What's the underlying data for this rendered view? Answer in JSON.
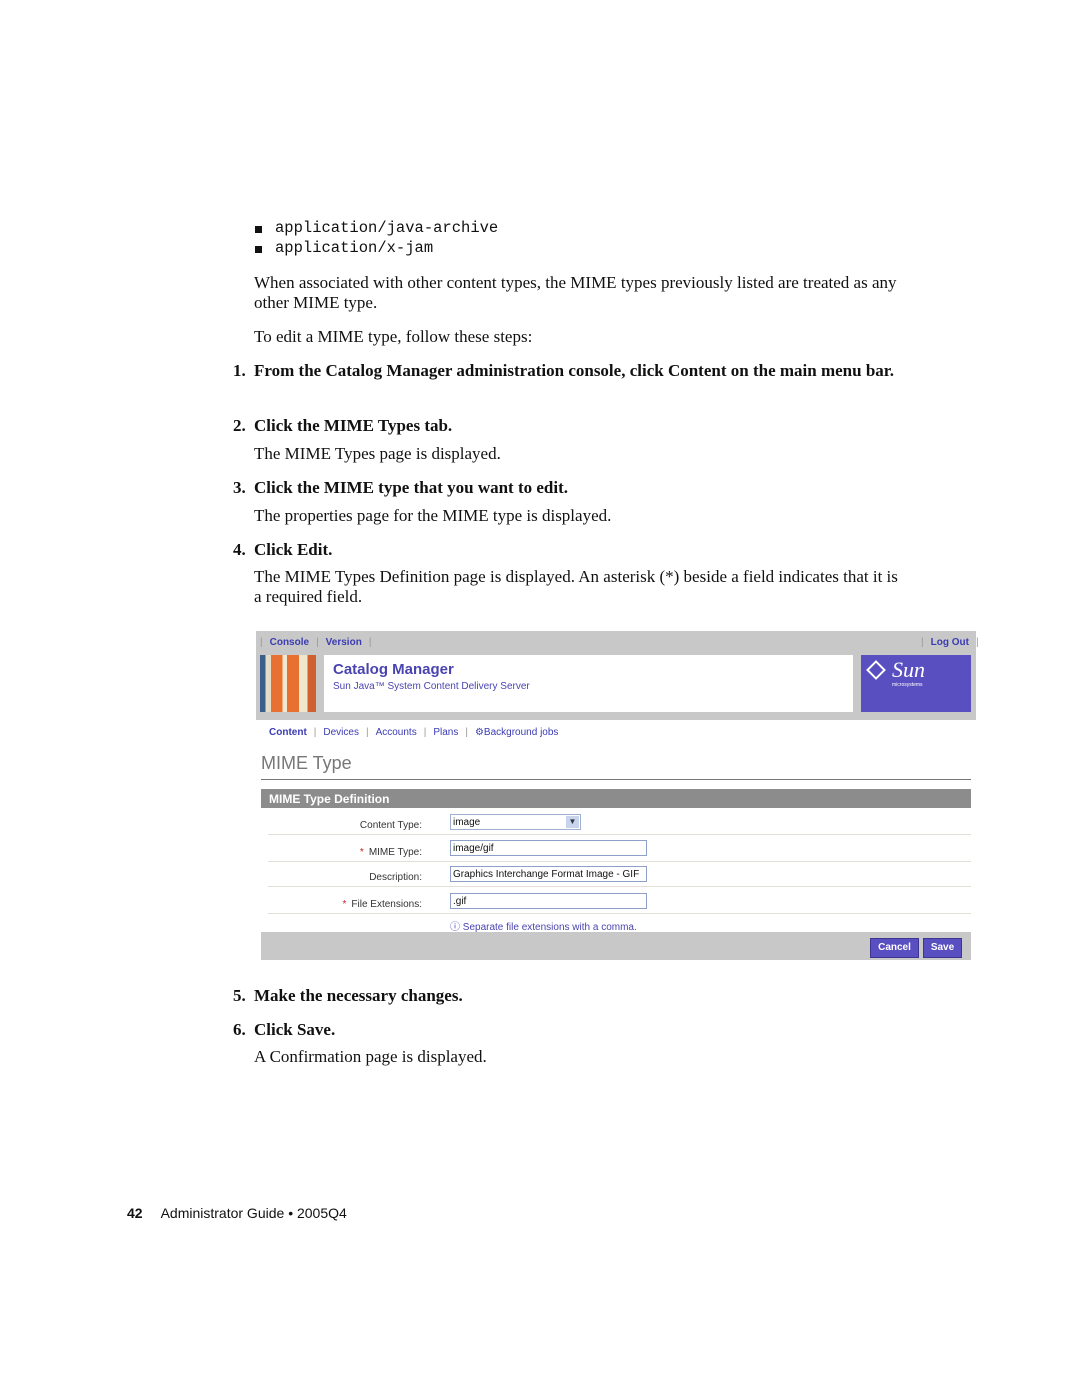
{
  "bullets": [
    "application/java-archive",
    "application/x-jam"
  ],
  "para1": "When associated with other content types, the MIME types previously listed are treated as any other MIME type.",
  "para2": "To edit a MIME type, follow these steps:",
  "steps": [
    {
      "n": "1.",
      "text": "From the Catalog Manager administration console, click Content on the main menu bar."
    },
    {
      "n": "2.",
      "text": "Click the MIME Types tab.",
      "result": "The MIME Types page is displayed."
    },
    {
      "n": "3.",
      "text": "Click the MIME type that you want to edit.",
      "result": "The properties page for the MIME type is displayed."
    },
    {
      "n": "4.",
      "text": "Click Edit.",
      "result": "The MIME Types Definition page is displayed. An asterisk (*) beside a field indicates that it is a required field."
    },
    {
      "n": "5.",
      "text": "Make the necessary changes."
    },
    {
      "n": "6.",
      "text": "Click Save.",
      "result": "A Confirmation page is displayed."
    }
  ],
  "screenshot": {
    "top_links": [
      "Console",
      "Version"
    ],
    "logout": "Log Out",
    "app_title": "Catalog Manager",
    "app_subtitle": "Sun Java™ System Content Delivery Server",
    "logo_text": "Sun",
    "logo_sub": "microsystems",
    "nav": [
      "Content",
      "Devices",
      "Accounts",
      "Plans",
      "Background jobs"
    ],
    "page_title": "MIME Type",
    "section_title": "MIME Type Definition",
    "fields": {
      "content_type": {
        "label": "Content Type:",
        "value": "image"
      },
      "mime_type": {
        "label": "MIME Type:",
        "value": "image/gif",
        "required": true
      },
      "description": {
        "label": "Description:",
        "value": "Graphics Interchange Format Image - GIF"
      },
      "file_extensions": {
        "label": "File Extensions:",
        "value": ".gif",
        "required": true
      }
    },
    "required_marker": "*",
    "hint": "Separate file extensions with a comma.",
    "cancel": "Cancel",
    "save": "Save",
    "colors": {
      "brand": "#5a4fc0",
      "link": "#3b3bb3",
      "header_gray": "#c8c8c8",
      "section_gray": "#8c8c8c"
    }
  },
  "footer": {
    "page": "42",
    "title": "Administrator Guide",
    "bullet": "•",
    "edition": "2005Q4"
  }
}
